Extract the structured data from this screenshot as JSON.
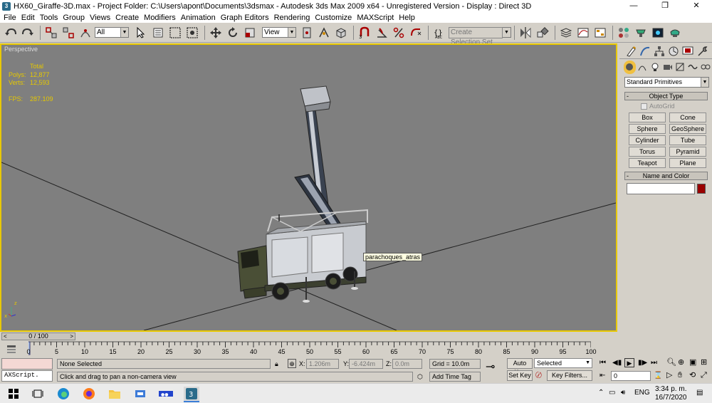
{
  "window": {
    "title": "HX60_Giraffe-3D.max     - Project Folder: C:\\Users\\apont\\Documents\\3dsmax     - Autodesk 3ds Max  2009 x64    - Unregistered Version     - Display : Direct 3D",
    "controls": [
      "—",
      "❐",
      "✕"
    ]
  },
  "menu": [
    "File",
    "Edit",
    "Tools",
    "Group",
    "Views",
    "Create",
    "Modifiers",
    "Animation",
    "Graph Editors",
    "Rendering",
    "Customize",
    "MAXScript",
    "Help"
  ],
  "toolbar": {
    "selection_filter": "All",
    "reference_coord": "View",
    "named_selection_placeholder": "Create Selection Set"
  },
  "viewport": {
    "label": "Perspective",
    "stats_header": "Total",
    "stats": [
      {
        "key": "Polys:",
        "value": "12,877"
      },
      {
        "key": "Verts:",
        "value": "12,593"
      }
    ],
    "fps_key": "FPS:",
    "fps_value": "287.109",
    "tooltip": "parachoques_atras",
    "accent": "#e8c800"
  },
  "command_panel": {
    "category": "Standard Primitives",
    "object_type_title": "Object Type",
    "autogrid_label": "AutoGrid",
    "primitives": [
      "Box",
      "Cone",
      "Sphere",
      "GeoSphere",
      "Cylinder",
      "Tube",
      "Torus",
      "Pyramid",
      "Teapot",
      "Plane"
    ],
    "name_color_title": "Name and Color",
    "object_color": "#9a0000"
  },
  "timeline": {
    "frame_display": "0 / 100",
    "ticks": [
      "0",
      "5",
      "10",
      "15",
      "20",
      "25",
      "30",
      "35",
      "40",
      "45",
      "50",
      "55",
      "60",
      "65",
      "70",
      "75",
      "80",
      "85",
      "90",
      "95",
      "100"
    ]
  },
  "status": {
    "maxscript_label": "AXScript.",
    "selection_status": "None Selected",
    "prompt": "Click and drag to pan a non-camera view",
    "x_label": "X:",
    "x_value": "1.206m",
    "y_label": "Y:",
    "y_value": "-6.424m",
    "z_label": "Z:",
    "z_value": "0.0m",
    "grid": "Grid = 10.0m",
    "add_time_tag": "Add Time Tag",
    "auto_key": "Auto Key",
    "set_key": "Set Key",
    "key_mode": "Selected",
    "key_filters": "Key Filters...",
    "current_frame": "0"
  },
  "taskbar": {
    "lang": "ENG",
    "time": "3:34 p. m.",
    "date": "16/7/2020"
  }
}
